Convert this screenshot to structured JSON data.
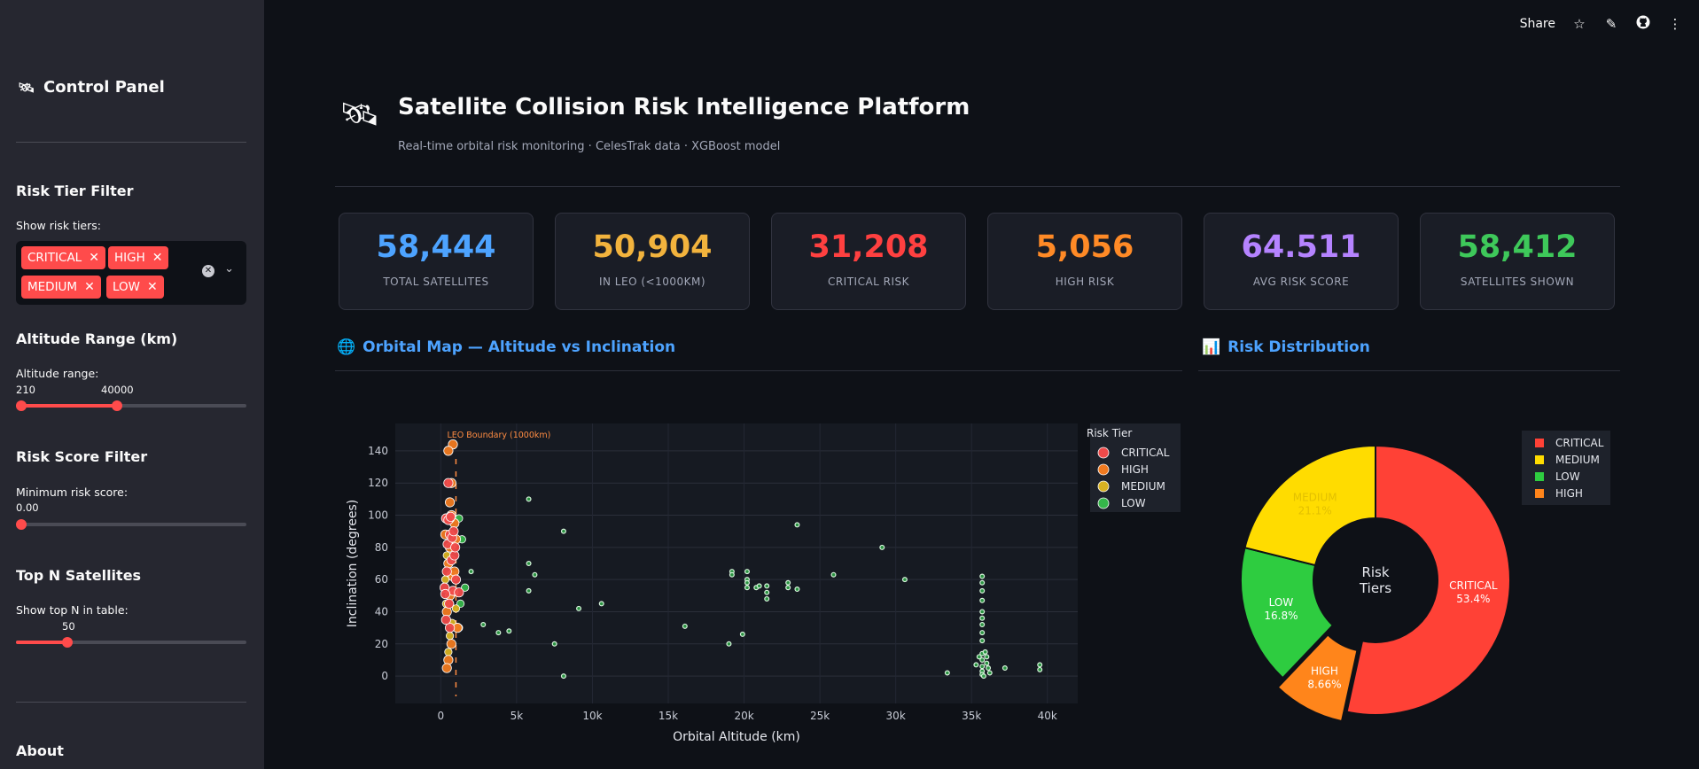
{
  "sidebar": {
    "title": "Control Panel",
    "risk_tier": {
      "section": "Risk Tier Filter",
      "label": "Show risk tiers:",
      "chips": [
        "CRITICAL",
        "HIGH",
        "MEDIUM",
        "LOW"
      ]
    },
    "altitude": {
      "section": "Altitude Range (km)",
      "label": "Altitude range:",
      "min_value": "210",
      "max_value": "40000"
    },
    "risk_score": {
      "section": "Risk Score Filter",
      "label": "Minimum risk score:",
      "value": "0.00"
    },
    "top_n": {
      "section": "Top N Satellites",
      "label": "Show top N in table:",
      "value": "50"
    },
    "about": "About"
  },
  "toolbar": {
    "share": "Share"
  },
  "header": {
    "title": "Satellite Collision Risk Intelligence Platform",
    "subtitle": "Real-time orbital risk monitoring · CelesTrak data · XGBoost model"
  },
  "metrics": [
    {
      "value": "58,444",
      "label": "TOTAL SATELLITES",
      "color": "#4da3ff"
    },
    {
      "value": "50,904",
      "label": "IN LEO (<1000KM)",
      "color": "#f2b33d"
    },
    {
      "value": "31,208",
      "label": "CRITICAL RISK",
      "color": "#ff4040"
    },
    {
      "value": "5,056",
      "label": "HIGH RISK",
      "color": "#ff8a26"
    },
    {
      "value": "64.511",
      "label": "AVG RISK SCORE",
      "color": "#b583ff"
    },
    {
      "value": "58,412",
      "label": "SATELLITES SHOWN",
      "color": "#3ec85a"
    }
  ],
  "sections": {
    "orbital": "Orbital Map — Altitude vs Inclination",
    "risk": "Risk Distribution"
  },
  "chart_data": [
    {
      "type": "scatter",
      "xlabel": "Orbital Altitude (km)",
      "ylabel": "Inclination (degrees)",
      "xlim": [
        -3000,
        42000
      ],
      "ylim": [
        -17,
        157
      ],
      "x_ticks": [
        0,
        5000,
        10000,
        15000,
        20000,
        25000,
        30000,
        35000,
        40000
      ],
      "x_tick_labels": [
        "0",
        "5k",
        "10k",
        "15k",
        "20k",
        "25k",
        "30k",
        "35k",
        "40k"
      ],
      "y_ticks": [
        0,
        20,
        40,
        60,
        80,
        100,
        120,
        140
      ],
      "annotation": "LEO Boundary (1000km)",
      "legend_title": "Risk Tier",
      "legend_placement": "right",
      "colors": {
        "CRITICAL": "#ef4a4a",
        "HIGH": "#f07a20",
        "MEDIUM": "#d8b222",
        "LOW": "#35b54a",
        "outline": "#ffffff"
      },
      "series": [
        {
          "name": "CRITICAL",
          "points": [
            [
              350,
              98
            ],
            [
              500,
              97
            ],
            [
              800,
              53
            ],
            [
              600,
              88
            ],
            [
              250,
              55
            ],
            [
              700,
              72
            ],
            [
              900,
              75
            ],
            [
              400,
              65
            ],
            [
              550,
              45
            ],
            [
              1200,
              52
            ],
            [
              300,
              51
            ],
            [
              450,
              82
            ],
            [
              650,
              99
            ],
            [
              750,
              86
            ],
            [
              850,
              90
            ],
            [
              950,
              80
            ],
            [
              500,
              120
            ],
            [
              600,
              30
            ],
            [
              350,
              35
            ],
            [
              1000,
              60
            ]
          ]
        },
        {
          "name": "HIGH",
          "points": [
            [
              600,
              108
            ],
            [
              700,
              120
            ],
            [
              800,
              144
            ],
            [
              500,
              140
            ],
            [
              400,
              98
            ],
            [
              700,
              100
            ],
            [
              900,
              95
            ],
            [
              300,
              88
            ],
            [
              600,
              80
            ],
            [
              1000,
              85
            ],
            [
              500,
              70
            ],
            [
              800,
              62
            ],
            [
              600,
              50
            ],
            [
              400,
              40
            ],
            [
              1100,
              30
            ],
            [
              700,
              20
            ],
            [
              500,
              10
            ],
            [
              400,
              5
            ],
            [
              900,
              65
            ],
            [
              600,
              98
            ]
          ]
        },
        {
          "name": "MEDIUM",
          "points": [
            [
              450,
              97
            ],
            [
              550,
              70
            ],
            [
              650,
              63
            ],
            [
              350,
              45
            ],
            [
              750,
              33
            ],
            [
              900,
              52
            ],
            [
              600,
              25
            ],
            [
              500,
              15
            ],
            [
              300,
              60
            ],
            [
              400,
              75
            ],
            [
              800,
              82
            ],
            [
              1000,
              42
            ],
            [
              1200,
              30
            ]
          ]
        },
        {
          "name": "LOW",
          "points": [
            [
              1200,
              98
            ],
            [
              1400,
              85
            ],
            [
              1600,
              55
            ],
            [
              1300,
              45
            ],
            [
              2000,
              65
            ],
            [
              2800,
              32
            ],
            [
              3800,
              27
            ],
            [
              4500,
              28
            ],
            [
              5800,
              110
            ],
            [
              5800,
              70
            ],
            [
              5800,
              53
            ],
            [
              6200,
              63
            ],
            [
              7500,
              20
            ],
            [
              8100,
              90
            ],
            [
              8100,
              0
            ],
            [
              9100,
              42
            ],
            [
              10600,
              45
            ],
            [
              16100,
              31
            ],
            [
              19000,
              20
            ],
            [
              19200,
              65
            ],
            [
              19200,
              63
            ],
            [
              19900,
              26
            ],
            [
              20200,
              55
            ],
            [
              20200,
              60
            ],
            [
              20200,
              58
            ],
            [
              20200,
              65
            ],
            [
              20800,
              55
            ],
            [
              21000,
              56
            ],
            [
              21500,
              48
            ],
            [
              21500,
              52
            ],
            [
              21500,
              56
            ],
            [
              22900,
              58
            ],
            [
              22900,
              55
            ],
            [
              23500,
              94
            ],
            [
              23500,
              54
            ],
            [
              25900,
              63
            ],
            [
              29100,
              80
            ],
            [
              30600,
              60
            ],
            [
              33400,
              2
            ],
            [
              35700,
              62
            ],
            [
              35700,
              58
            ],
            [
              35700,
              53
            ],
            [
              35700,
              47
            ],
            [
              35700,
              40
            ],
            [
              35700,
              36
            ],
            [
              35700,
              32
            ],
            [
              35700,
              27
            ],
            [
              35700,
              22
            ],
            [
              35700,
              14
            ],
            [
              35700,
              10
            ],
            [
              35700,
              6
            ],
            [
              35700,
              3
            ],
            [
              35700,
              1
            ],
            [
              35500,
              12
            ],
            [
              35900,
              15
            ],
            [
              36000,
              8
            ],
            [
              36100,
              5
            ],
            [
              35300,
              7
            ],
            [
              36200,
              2
            ],
            [
              37200,
              5
            ],
            [
              39500,
              7
            ],
            [
              39500,
              4
            ],
            [
              36000,
              12
            ],
            [
              35800,
              0
            ]
          ]
        }
      ]
    },
    {
      "type": "pie",
      "center_label": "Risk\nTiers",
      "legend_placement": "right",
      "slices": [
        {
          "label": "CRITICAL",
          "value": 53.4,
          "value_label": "53.4%",
          "color": "#ff4136"
        },
        {
          "label": "HIGH",
          "value": 8.66,
          "value_label": "8.66%",
          "color": "#ff851b"
        },
        {
          "label": "LOW",
          "value": 16.8,
          "value_label": "16.8%",
          "color": "#2ecc40"
        },
        {
          "label": "MEDIUM",
          "value": 21.1,
          "value_label": "21.1%",
          "color": "#ffdc00"
        }
      ],
      "legend_order": [
        "CRITICAL",
        "MEDIUM",
        "LOW",
        "HIGH"
      ]
    }
  ]
}
